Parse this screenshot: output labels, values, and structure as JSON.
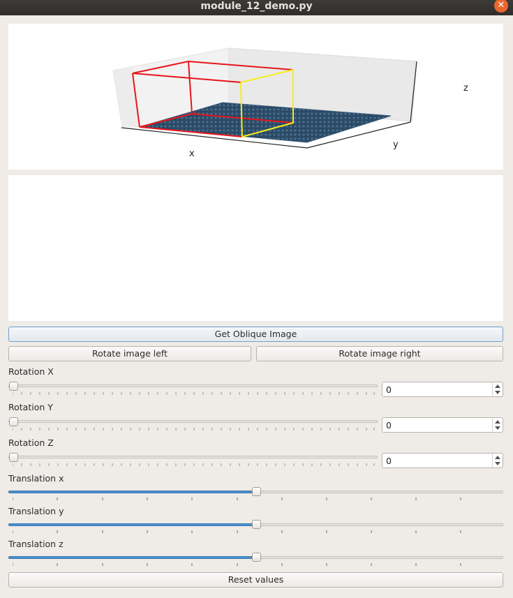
{
  "window": {
    "title": "module_12_demo.py",
    "close_glyph": "✕"
  },
  "plot": {
    "xlabel": "x",
    "ylabel": "y",
    "zlabel": "z",
    "colors": {
      "box": "#e8151b",
      "face": "#f5ef1a",
      "surface": "#2b4a66"
    }
  },
  "buttons": {
    "oblique": "Get Oblique Image",
    "rotate_left": "Rotate image left",
    "rotate_right": "Rotate image right",
    "reset": "Reset values"
  },
  "controls": {
    "rotation_x": {
      "label": "Rotation X",
      "value": "0",
      "slider_level": 0.0
    },
    "rotation_y": {
      "label": "Rotation Y",
      "value": "0",
      "slider_level": 0.0
    },
    "rotation_z": {
      "label": "Rotation Z",
      "value": "0",
      "slider_level": 0.0
    },
    "translation_x": {
      "label": "Translation x",
      "slider_level": 0.5
    },
    "translation_y": {
      "label": "Translation y",
      "slider_level": 0.5
    },
    "translation_z": {
      "label": "Translation z",
      "slider_level": 0.5
    }
  },
  "accent": "#4a90d0"
}
